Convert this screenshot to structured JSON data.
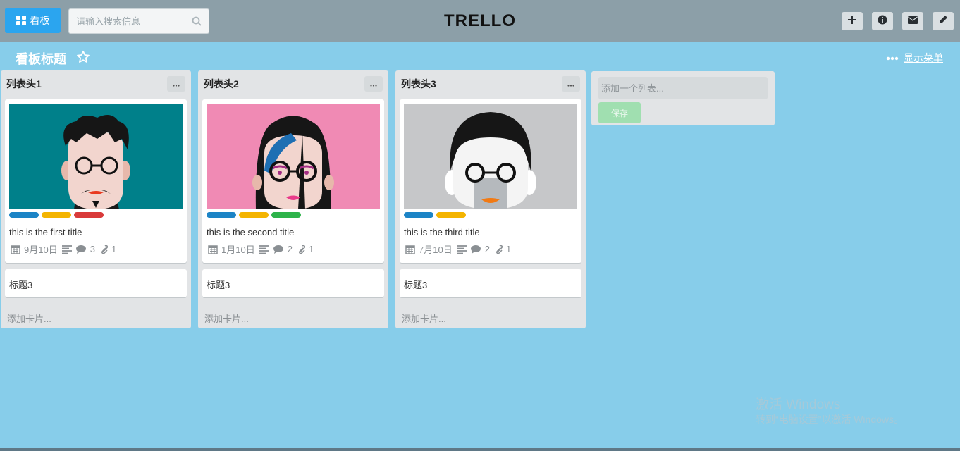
{
  "header": {
    "board_button_label": "看板",
    "search_placeholder": "请输入搜索信息",
    "logo": "TRELLO"
  },
  "board": {
    "title": "看板标题",
    "menu_label": "显示菜单"
  },
  "lists": [
    {
      "title": "列表头1",
      "card": {
        "title": "this is the first title",
        "date": "9月10日",
        "comments": "3",
        "attachments": "1",
        "cover_color": "#00808a",
        "labels": [
          "#1c84c6",
          "#f4b400",
          "#d93a3a"
        ]
      },
      "card2_title": "标题3",
      "add_card": "添加卡片..."
    },
    {
      "title": "列表头2",
      "card": {
        "title": "this is the second title",
        "date": "1月10日",
        "comments": "2",
        "attachments": "1",
        "cover_color": "#f08ab4",
        "labels": [
          "#1c84c6",
          "#f4b400",
          "#2db34a"
        ]
      },
      "card2_title": "标题3",
      "add_card": "添加卡片..."
    },
    {
      "title": "列表头3",
      "card": {
        "title": "this is the third title",
        "date": "7月10日",
        "comments": "2",
        "attachments": "1",
        "cover_color": "#c6c7c9",
        "labels": [
          "#1c84c6",
          "#f4b400"
        ]
      },
      "card2_title": "标题3",
      "add_card": "添加卡片..."
    }
  ],
  "add_list": {
    "placeholder": "添加一个列表...",
    "save_label": "保存"
  },
  "watermark": {
    "line1": "激活 Windows",
    "line2": "转到“电脑设置”以激活 Windows。"
  },
  "icons": [
    "grid-icon",
    "search-icon",
    "plus-icon",
    "info-icon",
    "mail-icon",
    "pencil-icon",
    "star-icon",
    "more-icon",
    "calendar-icon",
    "description-icon",
    "comment-icon",
    "paperclip-icon"
  ]
}
